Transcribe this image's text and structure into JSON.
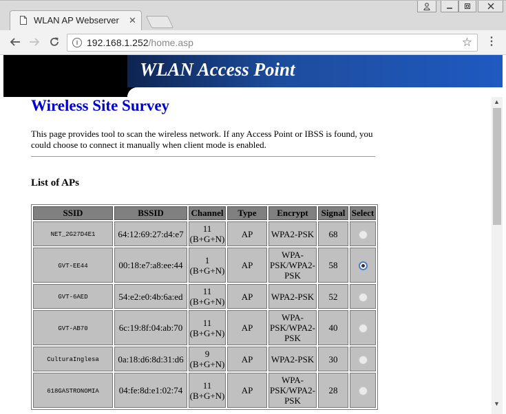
{
  "browser": {
    "tab_title": "WLAN AP Webserver",
    "tab_close": "✕",
    "url_host": "192.168.1.252",
    "url_path": "/home.asp",
    "window_buttons": {
      "user": "👤",
      "minimize": "—",
      "maximize": "☐",
      "close": "✕"
    }
  },
  "banner": {
    "title": "WLAN Access Point"
  },
  "page": {
    "title": "Wireless Site Survey",
    "description": "This page provides tool to scan the wireless network. If any Access Point or IBSS is found, you could choose to connect it manually when client mode is enabled.",
    "list_title": "List of APs"
  },
  "table": {
    "headers": [
      "SSID",
      "BSSID",
      "Channel",
      "Type",
      "Encrypt",
      "Signal",
      "Select"
    ],
    "rows": [
      {
        "ssid": "NET_2G27D4E1",
        "bssid": "64:12:69:27:d4:e7",
        "channel": "11",
        "band": "(B+G+N)",
        "type": "AP",
        "encrypt": "WPA2-PSK",
        "signal": "68",
        "selected": false
      },
      {
        "ssid": "GVT-EE44",
        "bssid": "00:18:e7:a8:ee:44",
        "channel": "1",
        "band": "(B+G+N)",
        "type": "AP",
        "encrypt": "WPA-PSK/WPA2-PSK",
        "signal": "58",
        "selected": true
      },
      {
        "ssid": "GVT-6AED",
        "bssid": "54:e2:e0:4b:6a:ed",
        "channel": "11",
        "band": "(B+G+N)",
        "type": "AP",
        "encrypt": "WPA2-PSK",
        "signal": "52",
        "selected": false
      },
      {
        "ssid": "GVT-AB70",
        "bssid": "6c:19:8f:04:ab:70",
        "channel": "11",
        "band": "(B+G+N)",
        "type": "AP",
        "encrypt": "WPA-PSK/WPA2-PSK",
        "signal": "40",
        "selected": false
      },
      {
        "ssid": "CulturaInglesa",
        "bssid": "0a:18:d6:8d:31:d6",
        "channel": "9",
        "band": "(B+G+N)",
        "type": "AP",
        "encrypt": "WPA2-PSK",
        "signal": "30",
        "selected": false
      },
      {
        "ssid": "618GASTRONOMIA",
        "bssid": "04:fe:8d:e1:02:74",
        "channel": "11",
        "band": "(B+G+N)",
        "type": "AP",
        "encrypt": "WPA-PSK/WPA2-PSK",
        "signal": "28",
        "selected": false
      }
    ]
  }
}
